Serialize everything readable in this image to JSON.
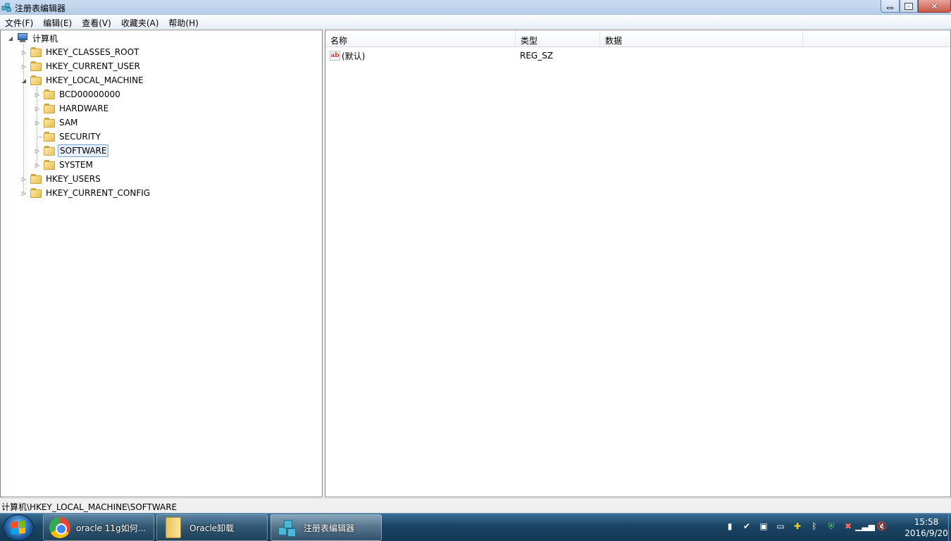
{
  "window": {
    "title": "注册表编辑器",
    "icon": "regedit-icon"
  },
  "menu": [
    "文件(F)",
    "编辑(E)",
    "查看(V)",
    "收藏夹(A)",
    "帮助(H)"
  ],
  "tree": {
    "root_label": "计算机",
    "hives": [
      {
        "label": "HKEY_CLASSES_ROOT",
        "expanded": false
      },
      {
        "label": "HKEY_CURRENT_USER",
        "expanded": false
      },
      {
        "label": "HKEY_LOCAL_MACHINE",
        "expanded": true
      },
      {
        "label": "HKEY_USERS",
        "expanded": false
      },
      {
        "label": "HKEY_CURRENT_CONFIG",
        "expanded": false
      }
    ],
    "hklm_children": [
      {
        "label": "BCD00000000",
        "has_children": true,
        "selected": false
      },
      {
        "label": "HARDWARE",
        "has_children": true,
        "selected": false
      },
      {
        "label": "SAM",
        "has_children": true,
        "selected": false
      },
      {
        "label": "SECURITY",
        "has_children": false,
        "selected": false
      },
      {
        "label": "SOFTWARE",
        "has_children": true,
        "selected": true
      },
      {
        "label": "SYSTEM",
        "has_children": true,
        "selected": false
      }
    ]
  },
  "values": {
    "columns": [
      "名称",
      "类型",
      "数据"
    ],
    "rows": [
      {
        "name": "(默认)",
        "type": "REG_SZ",
        "data": "",
        "icon": "ab"
      }
    ]
  },
  "status_path": "计算机\\HKEY_LOCAL_MACHINE\\SOFTWARE",
  "taskbar": {
    "items": [
      {
        "label": "oracle 11g如何...",
        "icon": "chrome-icon",
        "active": false
      },
      {
        "label": "Oracle卸载",
        "icon": "folder-icon",
        "active": false
      },
      {
        "label": "注册表编辑器",
        "icon": "regedit-icon",
        "active": true
      }
    ],
    "tray_icons": [
      "battery-icon",
      "network-check-icon",
      "device-icon",
      "display-icon",
      "update-icon",
      "bluetooth-icon",
      "shield-icon",
      "security-icon",
      "signal-icon",
      "volume-mute-icon"
    ],
    "time": "15:58",
    "date": "2016/9/20"
  }
}
